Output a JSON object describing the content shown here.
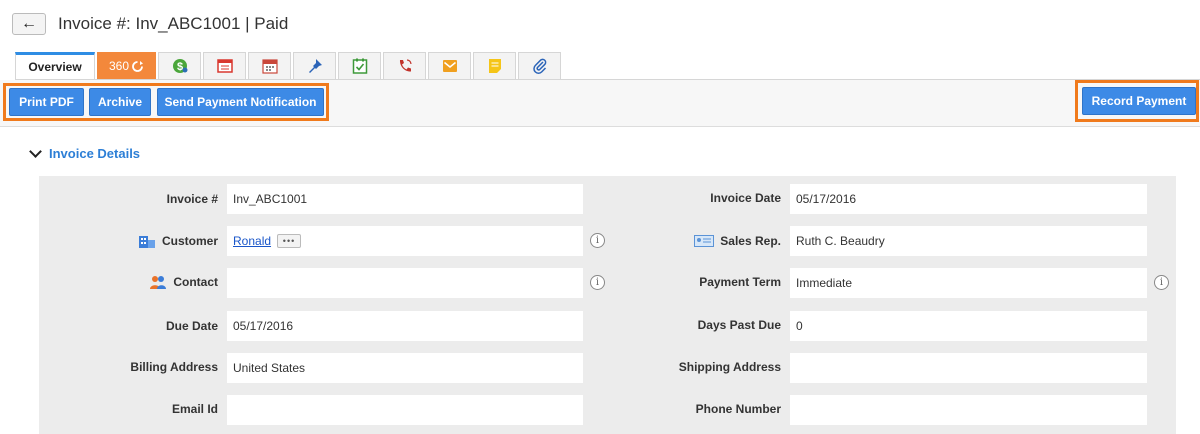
{
  "header": {
    "back_glyph": "←",
    "title": "Invoice #: Inv_ABC1001 | Paid"
  },
  "tabs": {
    "overview": "Overview",
    "t360": "360",
    "icons": [
      "dollar-icon",
      "invoice-icon",
      "calendar-icon",
      "pin-icon",
      "task-icon",
      "call-icon",
      "email-icon",
      "note-icon",
      "attachment-icon"
    ]
  },
  "toolbar": {
    "print_pdf": "Print PDF",
    "archive": "Archive",
    "send_payment_notification": "Send Payment Notification",
    "record_payment": "Record Payment"
  },
  "section": {
    "title": "Invoice Details"
  },
  "colors": {
    "accent": "#3d8ae6",
    "highlight": "#f07a1c",
    "tab_360": "#f3883b",
    "link": "#1a56c9"
  },
  "fields": {
    "invoice_no": {
      "label": "Invoice #",
      "value": "Inv_ABC1001"
    },
    "customer": {
      "label": "Customer",
      "value": "Ronald",
      "more": "•••"
    },
    "contact": {
      "label": "Contact",
      "value": ""
    },
    "due_date": {
      "label": "Due Date",
      "value": "05/17/2016"
    },
    "billing_address": {
      "label": "Billing Address",
      "value": "United States"
    },
    "email_id": {
      "label": "Email Id",
      "value": ""
    },
    "invoice_date": {
      "label": "Invoice Date",
      "value": "05/17/2016"
    },
    "sales_rep": {
      "label": "Sales Rep.",
      "value": "Ruth C. Beaudry"
    },
    "payment_term": {
      "label": "Payment Term",
      "value": "Immediate"
    },
    "days_past_due": {
      "label": "Days Past Due",
      "value": "0"
    },
    "shipping_address": {
      "label": "Shipping Address",
      "value": ""
    },
    "phone_number": {
      "label": "Phone Number",
      "value": ""
    }
  },
  "info_glyph": "i"
}
